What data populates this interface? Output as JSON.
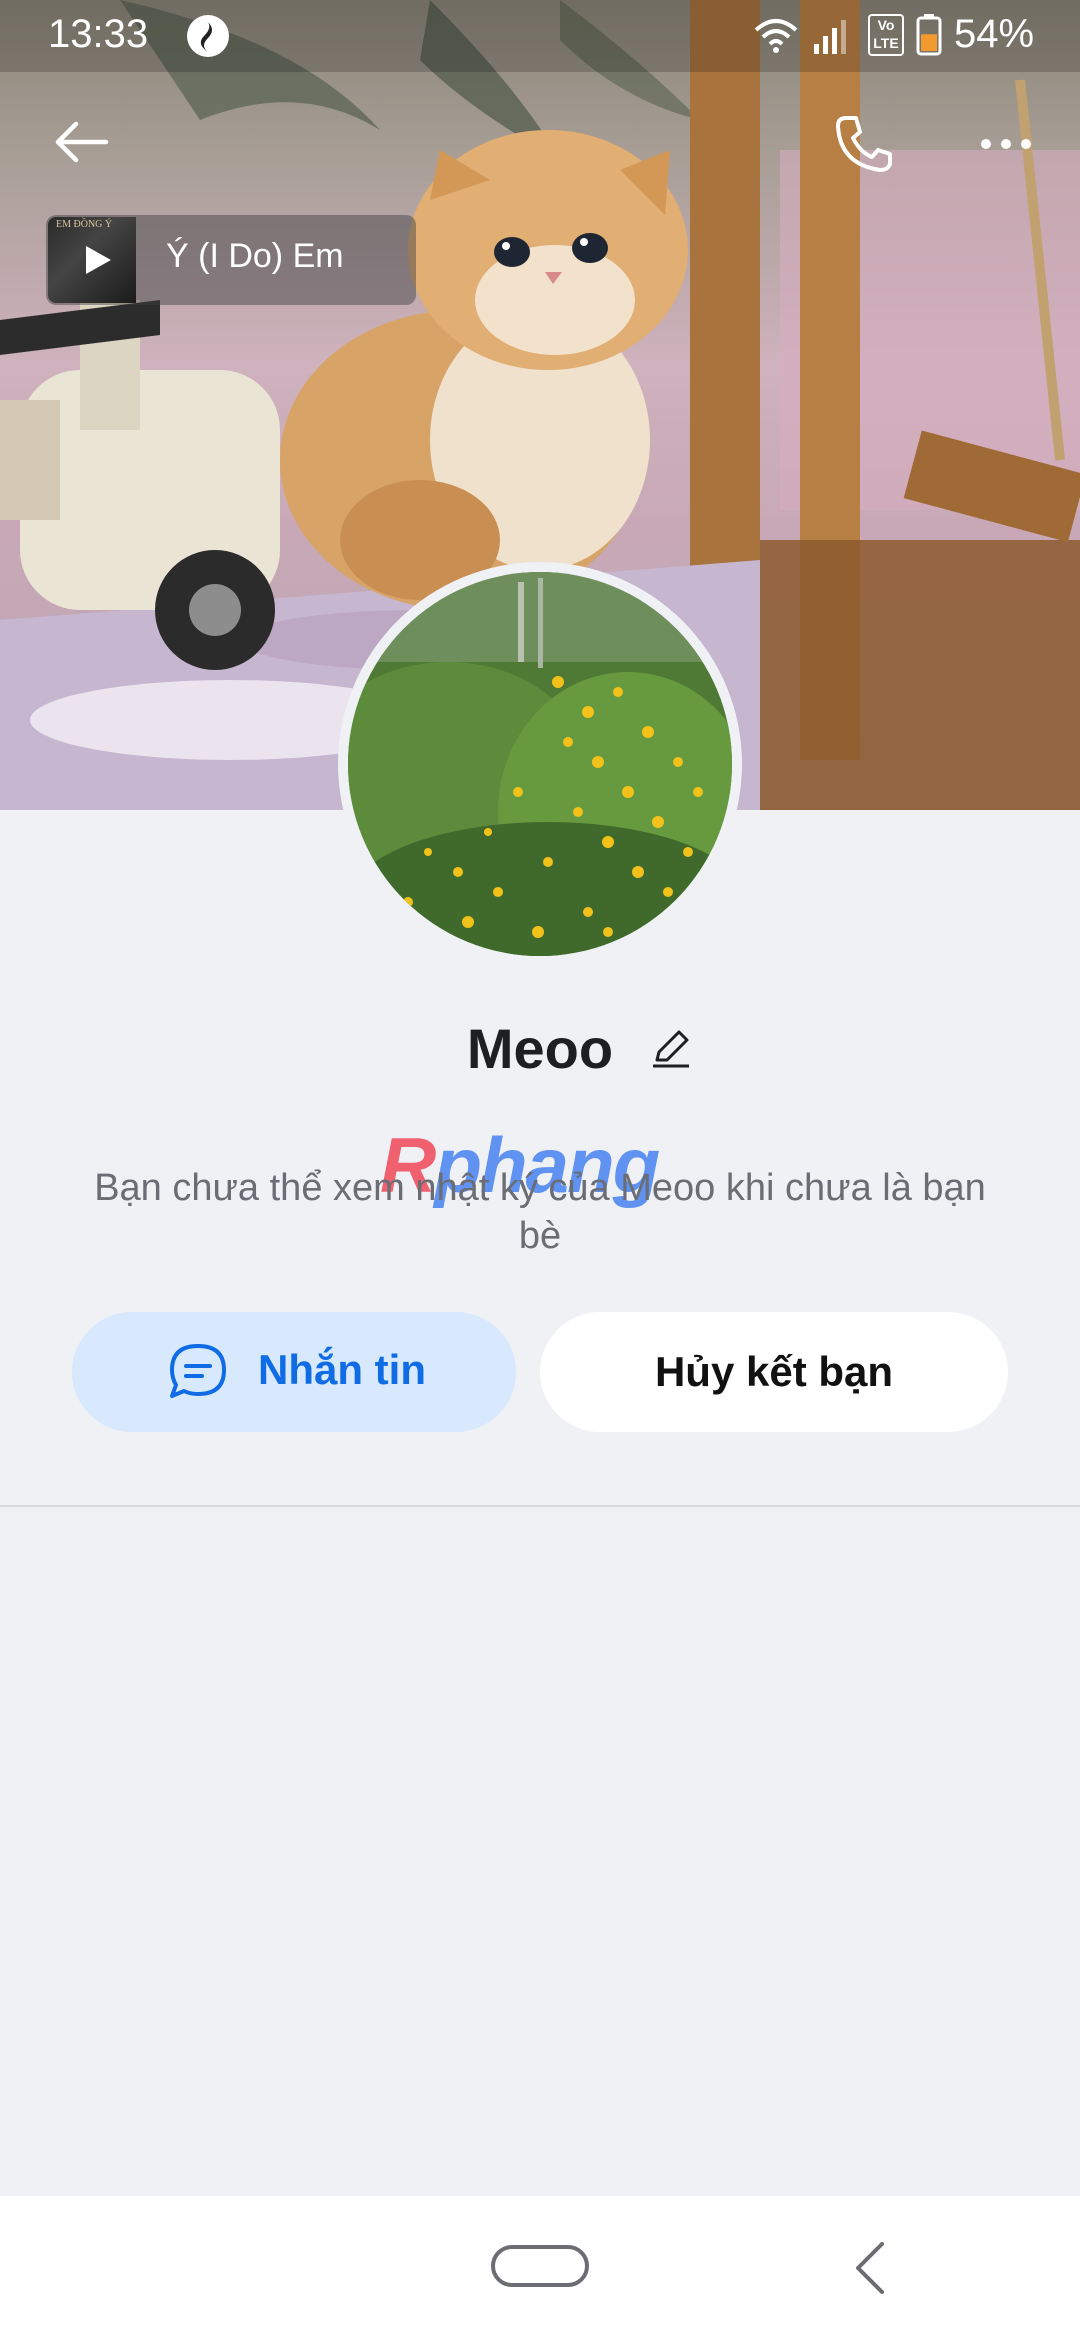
{
  "status_bar": {
    "time": "13:33",
    "network_badge": "Vo LTE",
    "battery_percent": "54%",
    "app_icon": "vietcombank-logo-icon",
    "wifi_icon": "wifi-icon",
    "signal_icon": "signal-icon",
    "battery_level": 0.54
  },
  "header": {
    "back_icon": "arrow-left-icon",
    "call_icon": "phone-icon",
    "more_icon": "more-horizontal-icon"
  },
  "music": {
    "title": "Ý (I Do)    Em",
    "cover_text": "EM ĐỒNG Ý",
    "play_icon": "play-icon"
  },
  "profile": {
    "name": "Meoo",
    "edit_icon": "pencil-icon",
    "privacy_note": "Bạn chưa thể xem nhật ký của Meoo khi chưa là bạn bè"
  },
  "watermark": {
    "part1": "R",
    "part2": "phang"
  },
  "actions": {
    "message_label": "Nhắn tin",
    "message_icon": "chat-bubble-icon",
    "unfriend_label": "Hủy kết bạn"
  },
  "colors": {
    "accent": "#0f6ce5",
    "accent_bg": "#d8e8fd",
    "page_bg": "#eff1f5"
  }
}
